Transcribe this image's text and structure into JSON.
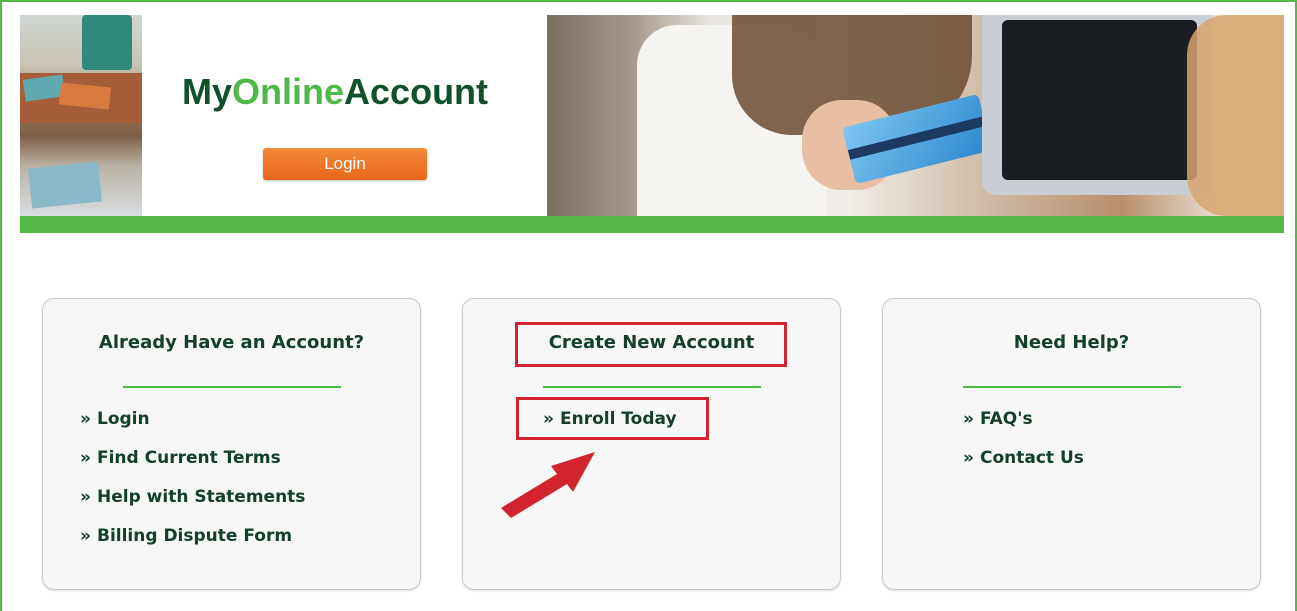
{
  "brand": {
    "title_prefix": "My",
    "title_accent": "Online",
    "title_suffix": "Account",
    "login_label": "Login",
    "accent_color": "#4fb848",
    "brand_color": "#10502a",
    "button_color": "#ec6c22"
  },
  "panels": [
    {
      "title": "Already Have an Account?",
      "links": [
        {
          "icon": "double-chevron-right-icon",
          "label": "Login"
        },
        {
          "icon": "double-chevron-right-icon",
          "label": "Find Current Terms"
        },
        {
          "icon": "double-chevron-right-icon",
          "label": "Help with Statements"
        },
        {
          "icon": "double-chevron-right-icon",
          "label": "Billing Dispute Form"
        }
      ]
    },
    {
      "title": "Create New Account",
      "links": [
        {
          "icon": "double-chevron-right-icon",
          "label": "Enroll Today"
        }
      ]
    },
    {
      "title": "Need Help?",
      "links": [
        {
          "icon": "double-chevron-right-icon",
          "label": "FAQ's"
        },
        {
          "icon": "double-chevron-right-icon",
          "label": "Contact Us"
        }
      ]
    }
  ],
  "chevron_glyph": "»",
  "annotation": {
    "highlight_color": "#d1242f",
    "arrow_icon": "red-arrow-icon"
  }
}
